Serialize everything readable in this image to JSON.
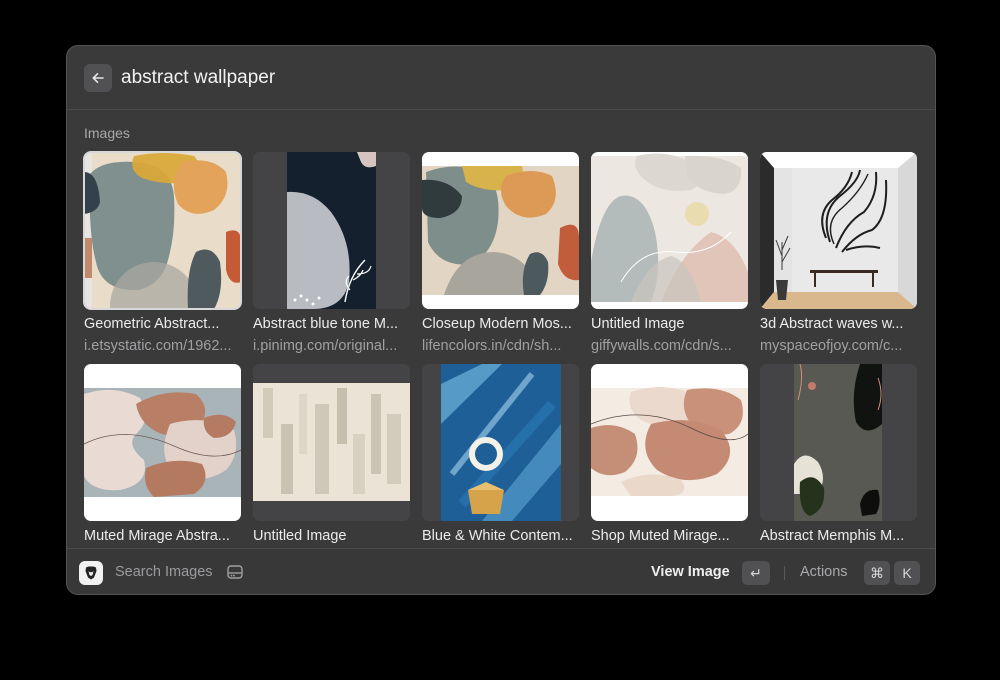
{
  "search": {
    "query": "abstract wallpaper"
  },
  "section": {
    "title": "Images"
  },
  "images": [
    {
      "title": "Geometric Abstract...",
      "source": "i.etsystatic.com/1962..."
    },
    {
      "title": "Abstract blue tone M...",
      "source": "i.pinimg.com/original..."
    },
    {
      "title": "Closeup Modern Mos...",
      "source": "lifencolors.in/cdn/sh..."
    },
    {
      "title": "Untitled Image",
      "source": "giffywalls.com/cdn/s..."
    },
    {
      "title": "3d Abstract waves w...",
      "source": "myspaceofjoy.com/c..."
    },
    {
      "title": "Muted Mirage Abstra...",
      "source": ""
    },
    {
      "title": "Untitled Image",
      "source": ""
    },
    {
      "title": "Blue & White Contem...",
      "source": ""
    },
    {
      "title": "Shop Muted Mirage...",
      "source": ""
    },
    {
      "title": "Abstract Memphis M...",
      "source": ""
    }
  ],
  "footer": {
    "search_label": "Search Images",
    "primary_action": "View Image",
    "primary_key": "↵",
    "actions_label": "Actions",
    "actions_keys": [
      "⌘",
      "K"
    ]
  },
  "icons": [
    "back-arrow-icon",
    "brave-lion-icon",
    "hard-drive-icon",
    "return-key-icon"
  ]
}
